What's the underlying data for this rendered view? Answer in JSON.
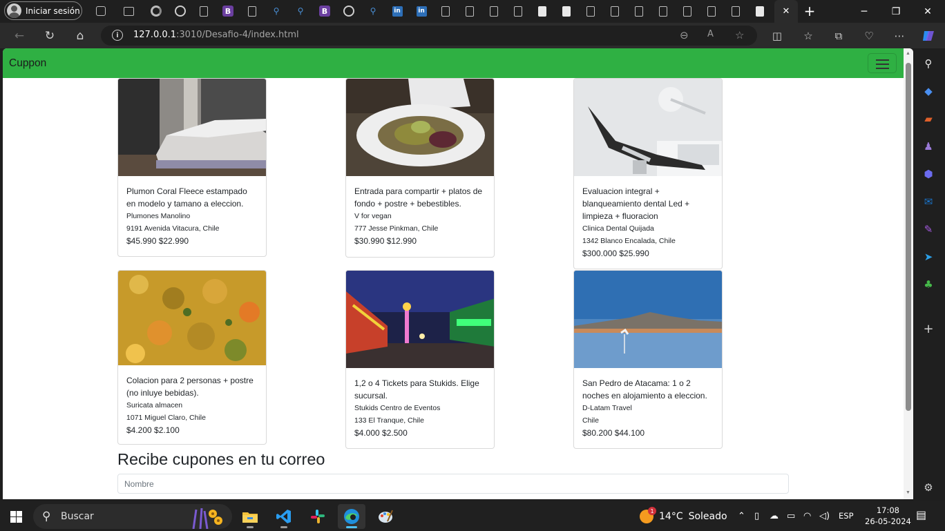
{
  "browser": {
    "profile_label": "Iniciar sesión",
    "url_host": "127.0.0.1",
    "url_rest": ":3010/Desafio-4/index.html",
    "window_controls": {
      "minimize": "─",
      "maximize": "❐",
      "close": "✕"
    },
    "new_tab": "+"
  },
  "site": {
    "brand": "Cuppon",
    "accent_color": "#2fb043"
  },
  "cards": [
    {
      "title": "Plumon Coral Fleece estampado en modelo y tamano a eleccion.",
      "vendor": "Plumones Manolino",
      "address": "9191 Avenida Vitacura, Chile",
      "price": "$45.990 $22.990",
      "image": "bedroom"
    },
    {
      "title": "Entrada para compartir + platos de fondo + postre + bebestibles.",
      "vendor": "V for vegan",
      "address": "777 Jesse Pinkman, Chile",
      "price": "$30.990 $12.990",
      "image": "vegan-dish"
    },
    {
      "title": "Evaluacion integral + blanqueamiento dental Led + limpieza + fluoracion",
      "vendor": "Clinica Dental Quijada",
      "address": "1342 Blanco Encalada, Chile",
      "price": "$300.000 $25.990",
      "image": "dental-chair"
    },
    {
      "title": "Colacion para 2 personas + postre (no inluye bebidas).",
      "vendor": "Suricata almacen",
      "address": "1071 Miguel Claro, Chile",
      "price": "$4.200 $2.100",
      "image": "food"
    },
    {
      "title": "1,2 o 4 Tickets para Stukids. Elige sucursal.",
      "vendor": "Stukids Centro de Eventos",
      "address": "133 El Tranque, Chile",
      "price": "$4.000 $2.500",
      "image": "fair"
    },
    {
      "title": "San Pedro de Atacama: 1 o 2 noches en alojamiento a eleccion.",
      "vendor": "D-Latam Travel",
      "address": "Chile",
      "price": "$80.200 $44.100",
      "image": "flamingo-lake"
    }
  ],
  "subscribe": {
    "title": "Recibe cupones en tu correo",
    "name_placeholder": "Nombre"
  },
  "taskbar": {
    "search_label": "Buscar",
    "weather_temp": "14°C",
    "weather_text": "Soleado",
    "language": "ESP",
    "time": "17:08",
    "date": "26-05-2024",
    "notification_count": "1"
  }
}
